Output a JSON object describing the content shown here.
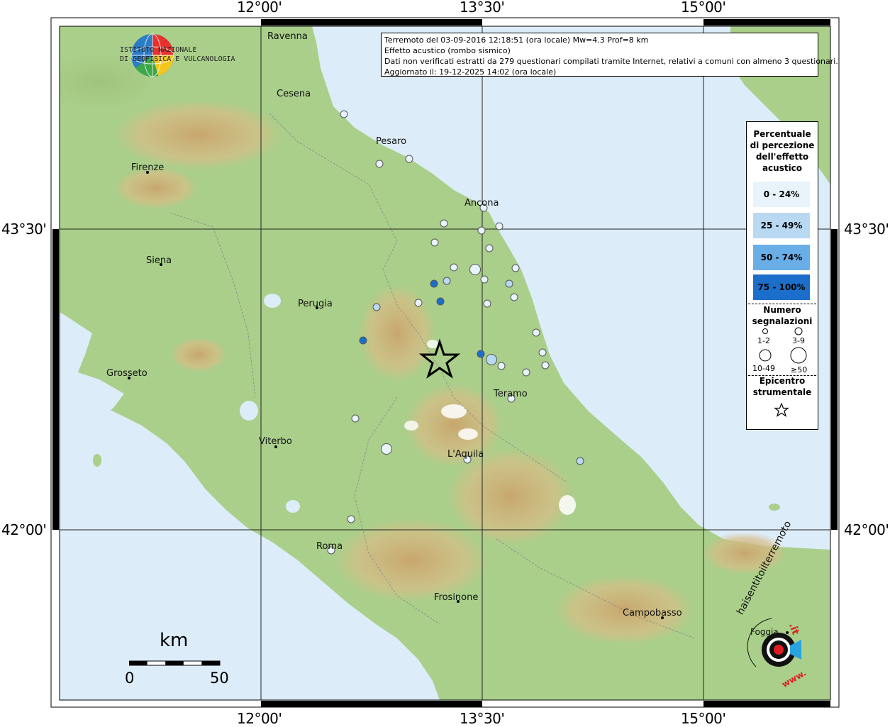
{
  "info": {
    "line1": "Terremoto del 03-09-2016 12:18:51 (ora locale) Mw=4.3 Prof=8 km",
    "line2": "Effetto acustico (rombo sismico)",
    "line3": "Dati non verificati estratti da 279 questionari compilati tramite Internet, relativi a comuni con almeno 3 questionari.",
    "line4": "Aggiornato il: 19-12-2025 14:02 (ora locale)"
  },
  "logo": {
    "line1": "ISTITUTO NAZIONALE",
    "line2": "DI GEOFISICA E VULCANOLOGIA"
  },
  "coords": {
    "top_left": "12°00'",
    "top_mid": "13°30'",
    "top_right": "15°00'",
    "left_top": "43°30'",
    "left_bottom": "42°00'",
    "right_top": "43°30'",
    "right_bottom": "42°00'",
    "bottom_left": "12°00'",
    "bottom_mid": "13°30'",
    "bottom_right": "15°00'"
  },
  "legend": {
    "title": [
      "Percentuale",
      "di percezione",
      "dell'effetto",
      "acustico"
    ],
    "bins": [
      {
        "label": "0 - 24%",
        "color": "#e8f3fc"
      },
      {
        "label": "25 - 49%",
        "color": "#b9d9f3"
      },
      {
        "label": "50 - 74%",
        "color": "#6aaee8"
      },
      {
        "label": "75 - 100%",
        "color": "#1b6fca"
      }
    ],
    "count_title": [
      "Numero",
      "segnalazioni"
    ],
    "sizes": [
      "1-2",
      "3-9",
      "10-49",
      "≥50"
    ],
    "epi_title": [
      "Epicentro",
      "strumentale"
    ]
  },
  "places": {
    "ravenna": "Ravenna",
    "cesena": "Cesena",
    "pesaro": "Pesaro",
    "firenze": "Firenze",
    "ancona": "Ancona",
    "siena": "Siena",
    "perugia": "Perugia",
    "grosseto": "Grosseto",
    "teramo": "Teramo",
    "viterbo": "Viterbo",
    "laquila": "L'Aquila",
    "roma": "Roma",
    "frosinone": "Frosinone",
    "campobasso": "Campobasso",
    "foggia": "Foggia"
  },
  "scale": {
    "unit": "km",
    "min": "0",
    "max": "50"
  },
  "hsi": {
    "brand": "haisentitoilterremoto",
    "tld": ".it",
    "www": "www."
  },
  "colors": {
    "sea": "#dcecf8",
    "land": "#a9cf8a",
    "mountain": "#c8a06a",
    "peak": "#ffffff"
  }
}
